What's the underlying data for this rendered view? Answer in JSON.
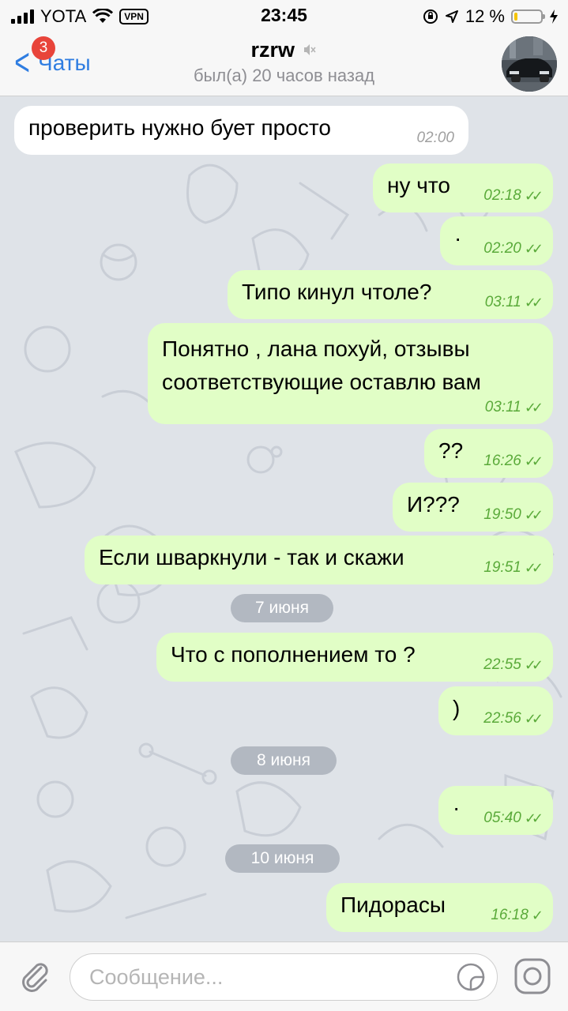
{
  "status_bar": {
    "carrier": "YOTA",
    "vpn": "VPN",
    "time": "23:45",
    "battery": "12 %",
    "battery_level": 0.12
  },
  "nav": {
    "back_label": "Чаты",
    "unread_badge": "3",
    "title": "rzrw",
    "subtitle": "был(а) 20 часов назад"
  },
  "messages": [
    {
      "dir": "in",
      "text": "проверить нужно бует просто",
      "time": "02:00"
    },
    {
      "dir": "out",
      "text": "ну что",
      "time": "02:18"
    },
    {
      "dir": "out",
      "text": "·",
      "time": "02:20"
    },
    {
      "dir": "out",
      "text": "Типо кинул чтоле?",
      "time": "03:11"
    },
    {
      "dir": "out",
      "text": "Понятно , лана похуй, отзывы соответствующие оставлю вам",
      "time": "03:11"
    },
    {
      "dir": "out",
      "text": "??",
      "time": "16:26"
    },
    {
      "dir": "out",
      "text": "И???",
      "time": "19:50"
    },
    {
      "dir": "out",
      "text": "Если шваркнули - так и скажи",
      "time": "19:51"
    },
    {
      "dir": "out",
      "text": "Что с пополнением то ?",
      "time": "22:55"
    },
    {
      "dir": "out",
      "text": ")",
      "time": "22:56"
    },
    {
      "dir": "out",
      "text": "·",
      "time": "05:40"
    },
    {
      "dir": "out",
      "text": "Пидорасы",
      "time": "16:18"
    }
  ],
  "dates": [
    "7 июня",
    "8 июня",
    "10 июня"
  ],
  "input": {
    "placeholder": "Сообщение..."
  },
  "colors": {
    "accent": "#2f7de1",
    "outgoing_bubble": "#e1fec6",
    "incoming_bubble": "#ffffff",
    "read_ticks": "#5aaa3a",
    "chat_background": "#dfe3e8",
    "badge": "#e8443a"
  }
}
